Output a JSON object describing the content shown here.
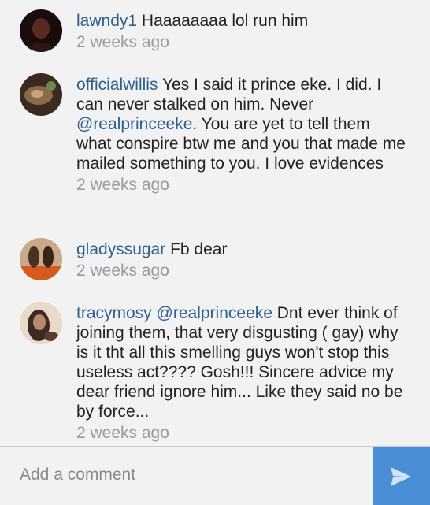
{
  "comments": [
    {
      "username": "lawndy1",
      "text": " Haaaaaaaa lol run him",
      "time": "2 weeks ago"
    },
    {
      "username": "officialwillis",
      "text_before": " Yes I said it prince eke. I did. I can never stalked on him. Never ",
      "mention": "@realprinceeke",
      "text_after": ". You are yet to tell them what conspire btw me and you that made me mailed something to you. I love evidences",
      "time": "2 weeks ago"
    },
    {
      "username": "gladyssugar",
      "text": " Fb dear",
      "time": "2 weeks ago"
    },
    {
      "username": "tracymosy",
      "mention": "@realprinceeke",
      "text_after": "  Dnt ever think of joining them, that very disgusting ( gay) why is it tht all this smelling guys won't stop this useless act???? Gosh!!! Sincere advice my dear friend ignore him... Like they said no be by force...",
      "time": "2 weeks ago"
    }
  ],
  "composer": {
    "placeholder": "Add a comment",
    "send_icon": "send-icon"
  }
}
